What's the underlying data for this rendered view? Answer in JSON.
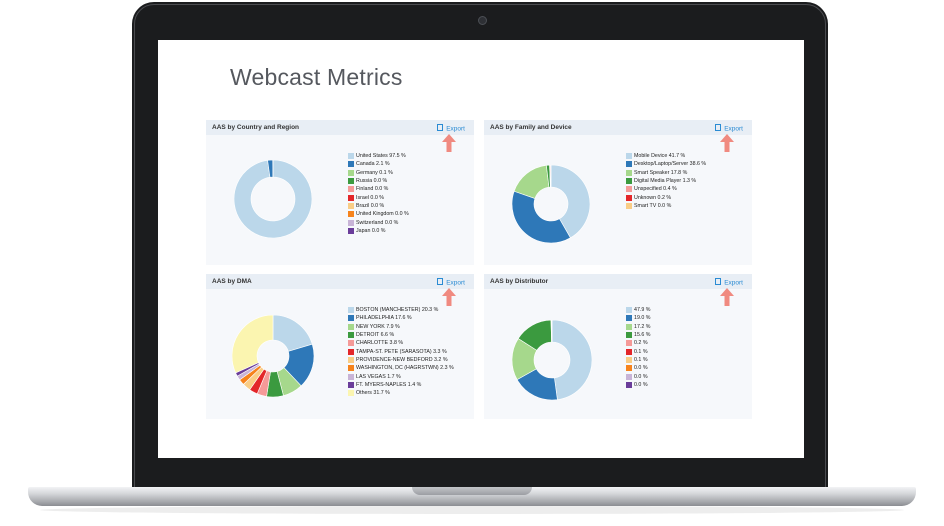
{
  "page": {
    "title": "Webcast Metrics"
  },
  "export_label": "Export",
  "panels": [
    {
      "title": "AAS by Country and Region",
      "legend": [
        {
          "label": "United States 97.5 %",
          "color": "#bbd7ea"
        },
        {
          "label": "Canada 2.1 %",
          "color": "#2e78b8"
        },
        {
          "label": "Germany 0.1 %",
          "color": "#a6d88c"
        },
        {
          "label": "Russia 0.0 %",
          "color": "#3b9a3f"
        },
        {
          "label": "Finland 0.0 %",
          "color": "#f59a98"
        },
        {
          "label": "Israel 0.0 %",
          "color": "#e3262a"
        },
        {
          "label": "Brazil 0.0 %",
          "color": "#f9cd86"
        },
        {
          "label": "United Kingdom 0.0 %",
          "color": "#f6831c"
        },
        {
          "label": "Switzerland 0.0 %",
          "color": "#c8b4d7"
        },
        {
          "label": "Japan 0.0 %",
          "color": "#6a3d9a"
        }
      ]
    },
    {
      "title": "AAS by Family and Device",
      "legend": [
        {
          "label": "Mobile Device 41.7 %",
          "color": "#bbd7ea"
        },
        {
          "label": "Desktop/Laptop/Server 38.6 %",
          "color": "#2e78b8"
        },
        {
          "label": "Smart Speaker 17.8 %",
          "color": "#a6d88c"
        },
        {
          "label": "Digital Media Player 1.3 %",
          "color": "#3b9a3f"
        },
        {
          "label": "Unspecified 0.4 %",
          "color": "#f59a98"
        },
        {
          "label": "Unknown 0.2 %",
          "color": "#e3262a"
        },
        {
          "label": "Smart TV 0.0 %",
          "color": "#f9cd86"
        }
      ]
    },
    {
      "title": "AAS by DMA",
      "legend": [
        {
          "label": "BOSTON (MANCHESTER) 20.3 %",
          "color": "#bbd7ea"
        },
        {
          "label": "PHILADELPHIA 17.6 %",
          "color": "#2e78b8"
        },
        {
          "label": "NEW YORK 7.9 %",
          "color": "#a6d88c"
        },
        {
          "label": "DETROIT 6.6 %",
          "color": "#3b9a3f"
        },
        {
          "label": "CHARLOTTE 3.8 %",
          "color": "#f59a98"
        },
        {
          "label": "TAMPA-ST. PETE (SARASOTA) 3.3 %",
          "color": "#e3262a"
        },
        {
          "label": "PROVIDENCE-NEW BEDFORD 3.2 %",
          "color": "#f9cd86"
        },
        {
          "label": "WASHINGTON, DC (HAGRSTWN) 2.3 %",
          "color": "#f6831c"
        },
        {
          "label": "LAS VEGAS 1.7 %",
          "color": "#c8b4d7"
        },
        {
          "label": "FT. MYERS-NAPLES 1.4 %",
          "color": "#6a3d9a"
        },
        {
          "label": "Others 31.7 %",
          "color": "#fbf5b0"
        }
      ]
    },
    {
      "title": "AAS by Distributor",
      "legend": [
        {
          "label": "47.9 %",
          "color": "#bbd7ea"
        },
        {
          "label": "19.0 %",
          "color": "#2e78b8"
        },
        {
          "label": "17.2 %",
          "color": "#a6d88c"
        },
        {
          "label": "15.6 %",
          "color": "#3b9a3f"
        },
        {
          "label": "0.2 %",
          "color": "#f59a98"
        },
        {
          "label": "0.1 %",
          "color": "#e3262a"
        },
        {
          "label": "0.1 %",
          "color": "#f9cd86"
        },
        {
          "label": "0.0 %",
          "color": "#f6831c"
        },
        {
          "label": "0.0 %",
          "color": "#c8b4d7"
        },
        {
          "label": "0.0 %",
          "color": "#6a3d9a"
        }
      ]
    }
  ],
  "chart_data": [
    {
      "type": "pie",
      "title": "AAS by Country and Region",
      "categories": [
        "United States",
        "Canada",
        "Germany",
        "Russia",
        "Finland",
        "Israel",
        "Brazil",
        "United Kingdom",
        "Switzerland",
        "Japan"
      ],
      "values": [
        97.5,
        2.1,
        0.1,
        0.0,
        0.0,
        0.0,
        0.0,
        0.0,
        0.0,
        0.0
      ]
    },
    {
      "type": "pie",
      "title": "AAS by Family and Device",
      "categories": [
        "Mobile Device",
        "Desktop/Laptop/Server",
        "Smart Speaker",
        "Digital Media Player",
        "Unspecified",
        "Unknown",
        "Smart TV"
      ],
      "values": [
        41.7,
        38.6,
        17.8,
        1.3,
        0.4,
        0.2,
        0.0
      ]
    },
    {
      "type": "pie",
      "title": "AAS by DMA",
      "categories": [
        "BOSTON (MANCHESTER)",
        "PHILADELPHIA",
        "NEW YORK",
        "DETROIT",
        "CHARLOTTE",
        "TAMPA-ST. PETE (SARASOTA)",
        "PROVIDENCE-NEW BEDFORD",
        "WASHINGTON, DC (HAGRSTWN)",
        "LAS VEGAS",
        "FT. MYERS-NAPLES",
        "Others"
      ],
      "values": [
        20.3,
        17.6,
        7.9,
        6.6,
        3.8,
        3.3,
        3.2,
        2.3,
        1.7,
        1.4,
        31.7
      ]
    },
    {
      "type": "pie",
      "title": "AAS by Distributor",
      "categories": [
        "47.9 %",
        "19.0 %",
        "17.2 %",
        "15.6 %",
        "0.2 %",
        "0.1 %",
        "0.1 %",
        "0.0 %",
        "0.0 %",
        "0.0 %"
      ],
      "values": [
        47.9,
        19.0,
        17.2,
        15.6,
        0.2,
        0.1,
        0.1,
        0.0,
        0.0,
        0.0
      ]
    }
  ]
}
